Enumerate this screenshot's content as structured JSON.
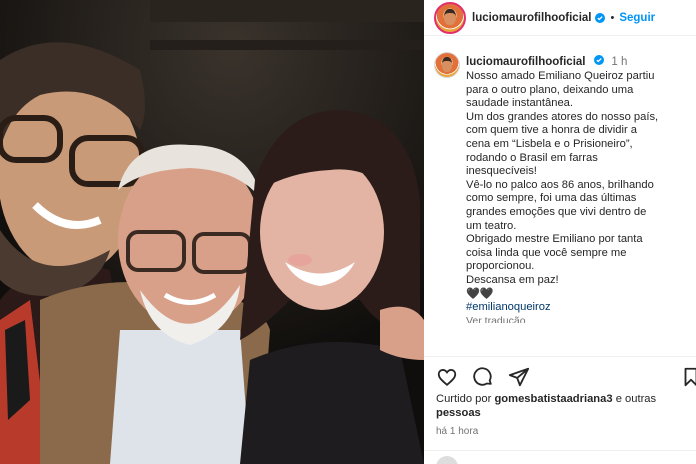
{
  "post": {
    "username": "luciomaurofilhooficial",
    "follow_label": "Seguir",
    "separator": "•",
    "time_short": "1 h",
    "caption_lines": [
      "Nosso amado Emiliano Queiroz partiu",
      "para o outro plano, deixando uma",
      "saudade instantânea.",
      "Um dos grandes atores do nosso país,",
      "com quem tive a honra de dividir a",
      "cena em “Lisbela e o Prisioneiro”,",
      "rodando o Brasil em farras",
      "inesquecíveis!",
      "Vê-lo no palco aos 86 anos, brilhando",
      "como sempre, foi uma das últimas",
      "grandes emoções que vivi dentro de",
      "um teatro.",
      "Obrigado mestre Emiliano por tanta",
      "coisa linda que você sempre me",
      "proporcionou.",
      "Descansa em paz!",
      "🖤🖤"
    ],
    "hashtag": "#emilianoqueiroz",
    "translate_label": "Ver tradução",
    "likes_prefix": "Curtido por ",
    "likes_user": "gomesbatistaadriana3",
    "likes_suffix": " e outras",
    "likes_line2": "pessoas",
    "time_ago": "há 1 hora"
  },
  "icons": {
    "verified": "verified-badge-icon",
    "like": "heart-icon",
    "comment": "comment-icon",
    "share": "send-icon",
    "save": "bookmark-icon"
  },
  "colors": {
    "follow": "#0095f6",
    "verified": "#0095f6",
    "text": "#262626",
    "muted": "#737373",
    "hashtag": "#00376b"
  }
}
